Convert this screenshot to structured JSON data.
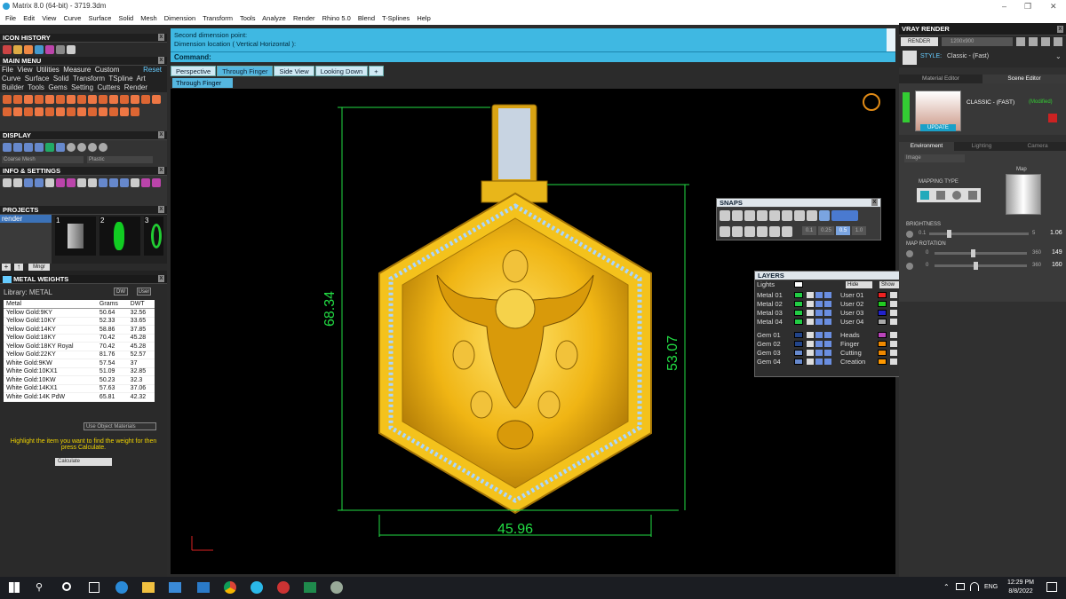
{
  "window": {
    "title": "Matrix 8.0 (64-bit) - 3719.3dm"
  },
  "menu": [
    "File",
    "Edit",
    "View",
    "Curve",
    "Surface",
    "Solid",
    "Mesh",
    "Dimension",
    "Transform",
    "Tools",
    "Analyze",
    "Render",
    "Rhino 5.0",
    "Blend",
    "T-Splines",
    "Help"
  ],
  "left": {
    "icon_history": "ICON HISTORY",
    "main_menu": "MAIN MENU",
    "main_menu_items": [
      "File",
      "View",
      "Utilities",
      "Measure",
      "Custom"
    ],
    "reset": "Reset",
    "menu_row2": [
      "Curve",
      "Surface",
      "Solid",
      "Transform",
      "TSpline",
      "Art"
    ],
    "menu_row3": [
      "Builder",
      "Tools",
      "Gems",
      "Setting",
      "Cutters",
      "Render"
    ],
    "display": "DISPLAY",
    "display_mode_1": "Coarse Mesh",
    "display_mode_2": "Plastic",
    "info_settings": "INFO & SETTINGS",
    "projects": "PROJECTS",
    "project_item": "render",
    "project_nums": [
      "1",
      "2",
      "3"
    ],
    "mngr": "Mngr",
    "metal_weights": "METAL WEIGHTS",
    "library": "Library: METAL",
    "dw": "DW",
    "user": "User",
    "columns": [
      "Metal",
      "Grams",
      "DWT"
    ],
    "rows": [
      [
        "Yellow Gold:9KY",
        "50.64",
        "32.56"
      ],
      [
        "Yellow Gold:10KY",
        "52.33",
        "33.65"
      ],
      [
        "Yellow Gold:14KY",
        "58.86",
        "37.85"
      ],
      [
        "Yellow Gold:18KY",
        "70.42",
        "45.28"
      ],
      [
        "Yellow Gold:18KY Royal",
        "70.42",
        "45.28"
      ],
      [
        "Yellow Gold:22KY",
        "81.76",
        "52.57"
      ],
      [
        "White Gold:9KW",
        "57.54",
        "37"
      ],
      [
        "White Gold:10KX1",
        "51.09",
        "32.85"
      ],
      [
        "White Gold:10KW",
        "50.23",
        "32.3"
      ],
      [
        "White Gold:14KX1",
        "57.63",
        "37.06"
      ],
      [
        "White Gold:14K PdW",
        "65.81",
        "42.32"
      ]
    ],
    "use_object_materials": "Use Object Materials",
    "hint": "Highlight the item you want to find the weight for then press Calculate.",
    "calculate": "Calculate"
  },
  "command": {
    "line1": "Second dimension point:",
    "line2": "Dimension location ( Vertical  Horizontal ):",
    "prompt": "Command:"
  },
  "viewport_tabs": [
    "Perspective",
    "Through Finger",
    "Side View",
    "Looking Down"
  ],
  "active_tab": "Through Finger",
  "viewport_label": "Through Finger",
  "dimensions": {
    "height_total": "68.34",
    "height_body": "53.07",
    "width": "45.96"
  },
  "snaps": {
    "title": "SNAPS",
    "values": [
      "0.1",
      "0.25",
      "0.5",
      "1.0"
    ]
  },
  "layers": {
    "title": "LAYERS",
    "lights": "Lights",
    "hide": "Hide",
    "show": "Show",
    "left_col": [
      {
        "name": "Metal 01",
        "color": "#22cc44"
      },
      {
        "name": "Metal 02",
        "color": "#22cc44"
      },
      {
        "name": "Metal 03",
        "color": "#22cc44"
      },
      {
        "name": "Metal 04",
        "color": "#22cc44"
      },
      {
        "name": "Gem 01",
        "color": "#224488"
      },
      {
        "name": "Gem 02",
        "color": "#224488"
      },
      {
        "name": "Gem 03",
        "color": "#6688cc"
      },
      {
        "name": "Gem 04",
        "color": "#6688cc"
      }
    ],
    "right_col": [
      {
        "name": "User 01",
        "color": "#ee2222"
      },
      {
        "name": "User 02",
        "color": "#22cc22"
      },
      {
        "name": "User 03",
        "color": "#2222cc"
      },
      {
        "name": "User 04",
        "color": "#aaaaaa"
      },
      {
        "name": "Heads",
        "color": "#bb44bb"
      },
      {
        "name": "Finger",
        "color": "#ee8800"
      },
      {
        "name": "Cutting",
        "color": "#ee8800"
      },
      {
        "name": "Creation",
        "color": "#ff9900"
      }
    ]
  },
  "vray": {
    "title": "VRAY RENDER",
    "render": "RENDER",
    "resolution": "1200x900",
    "style_label": "STYLE:",
    "style_value": "Classic - (Fast)",
    "tab_material": "Material Editor",
    "tab_scene": "Scene Editor",
    "preset": "CLASSIC - (FAST)",
    "modified": "(Modified)",
    "update": "UPDATE",
    "sub_tabs": [
      "Environment",
      "Lighting",
      "Camera"
    ],
    "env_type": "Image",
    "mapping_type": "MAPPING TYPE",
    "map": "Map",
    "brightness": "BRIGHTNESS",
    "brightness_min": "0.1",
    "brightness_max": "5",
    "brightness_val": "1.06",
    "map_rotation": "MAP ROTATION",
    "rot_min": "0",
    "rot_max": "360",
    "rot1": "149",
    "rot2": "160"
  },
  "taskbar": {
    "time": "12:29 PM",
    "date": "8/8/2022",
    "lang": "ENG"
  }
}
